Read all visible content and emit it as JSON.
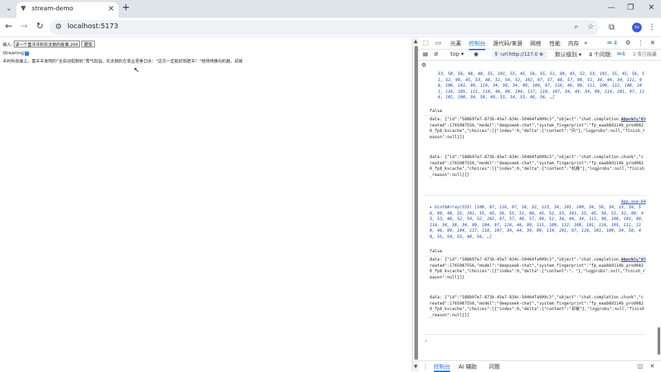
{
  "browser": {
    "tab_title": "stream-demo",
    "url": "localhost:5173",
    "avatar": "su"
  },
  "page": {
    "input_label": "输入:",
    "input_value": "讲一个喜洋洋和灰太狼的故事,200",
    "submit_label": "提交",
    "streaming_label": "Streaming",
    "output_text": "羊村科技展上，喜羊羊发明的“全自动捉狼机”青气四溢。灰太狼趴在草丛里垂口水：“这次一定能抓到肥羊！”他悄悄摸向机器，却被"
  },
  "devtools": {
    "tabs": [
      "元素",
      "控制台",
      "源代码/来源",
      "网络",
      "性能",
      "内存"
    ],
    "active_tab": "控制台",
    "issues_badge": "4",
    "context": "top",
    "filter_value": "-url:http://127.0",
    "level": "默认级别",
    "issues_count": "4 个问题:",
    "issues_count_badge": "4",
    "hidden": "2 条已隐藏",
    "entries": [
      {
        "kind": "array-cont",
        "text": "53, 58, 56, 98, 48, 55, 101, 55, 45, 56, 55, 51, 98, 45, 52, 53, 101, 55, 45, 56, 51, 52, 99, 45, 53, 48, 52, 54, 52, 102, 97, 57, 48, 57, 99, 51, 34, 44, 34, 111, 98, 106, 101, 99, 116, 34, 58, 34, 99, 104, 97, 116, 46, 99, 111, 109, 112, 108, 101, 116, 105, 111, 110, 46, 99, 104, 117, 110, 107, 34, 44, 34, 99, 114, 101, 97, 116, 101, 100, 34, 58, 49, 55, 54, 53, 48, 56, …]"
      },
      {
        "kind": "plain",
        "text": "false"
      },
      {
        "kind": "data",
        "src": "App.vue:69",
        "text": "data: {\"id\":\"588b07e7-873b-45e7-834c-50464fa909c3\",\"object\":\"chat.completion.chunk\",\"created\":1765087556,\"model\":\"deepseek-chat\",\"system_fingerprint\":\"fp_eaab8d114b_prod0820_fp8_kvcache\",\"choices\":[{\"index\":0,\"delta\":{\"content\":\"向\"},\"logprobs\":null,\"finish_reason\":null}]}"
      },
      {
        "kind": "data",
        "src": "",
        "text": "data: {\"id\":\"588b07e7-873b-45e7-834c-50464fa909c3\",\"object\":\"chat.completion.chunk\",\"created\":1765087556,\"model\":\"deepseek-chat\",\"system_fingerprint\":\"fp_eaab8d114b_prod0820_fp8_kvcache\",\"choices\":[{\"index\":0,\"delta\":{\"content\":\"机器\"},\"logprobs\":null,\"finish_reason\":null}]}"
      },
      {
        "kind": "array",
        "src": "App.vue:64",
        "text": "▸ Uint8Array(555) [100, 97, 116, 97, 58, 32, 123, 34, 105, 100, 34, 58, 34, 53, 56, 56, 98, 48, 55, 101, 55, 45, 56, 55, 51, 98, 45, 52, 53, 101, 55, 45, 56, 51, 52, 99, 45, 53, 48, 52, 54, 52, 102, 97, 57, 48, 57, 99, 51, 34, 44, 34, 111, 98, 106, 101, 99, 116, 34, 58, 34, 99, 104, 97, 116, 46, 99, 111, 109, 112, 108, 101, 116, 105, 111, 110, 46, 99, 104, 117, 110, 107, 34, 44, 34, 99, 114, 101, 97, 116, 101, 100, 34, 58, 49, 55, 54, 53, 48, 56, …]"
      },
      {
        "kind": "plain",
        "text": "false"
      },
      {
        "kind": "data",
        "src": "App.vue:69",
        "text": "data: {\"id\":\"588b07e7-873b-45e7-834c-50464fa909c3\",\"object\":\"chat.completion.chunk\",\"created\":1765087556,\"model\":\"deepseek-chat\",\"system_fingerprint\":\"fp_eaab8d114b_prod0820_fp8_kvcache\",\"choices\":[{\"index\":0,\"delta\":{\"content\":\"，\"},\"logprobs\":null,\"finish_reason\":null}]}"
      },
      {
        "kind": "data",
        "src": "",
        "text": "data: {\"id\":\"588b07e7-873b-45e7-834c-50464fa909c3\",\"object\":\"chat.completion.chunk\",\"created\":1765087556,\"model\":\"deepseek-chat\",\"system_fingerprint\":\"fp_eaab8d114b_prod0820_fp8_kvcache\",\"choices\":[{\"index\":0,\"delta\":{\"content\":\"却被\"},\"logprobs\":null,\"finish_reason\":null}]}"
      }
    ],
    "prompt": "›",
    "drawer_tabs": [
      "控制台",
      "AI 辅助",
      "问题"
    ]
  }
}
